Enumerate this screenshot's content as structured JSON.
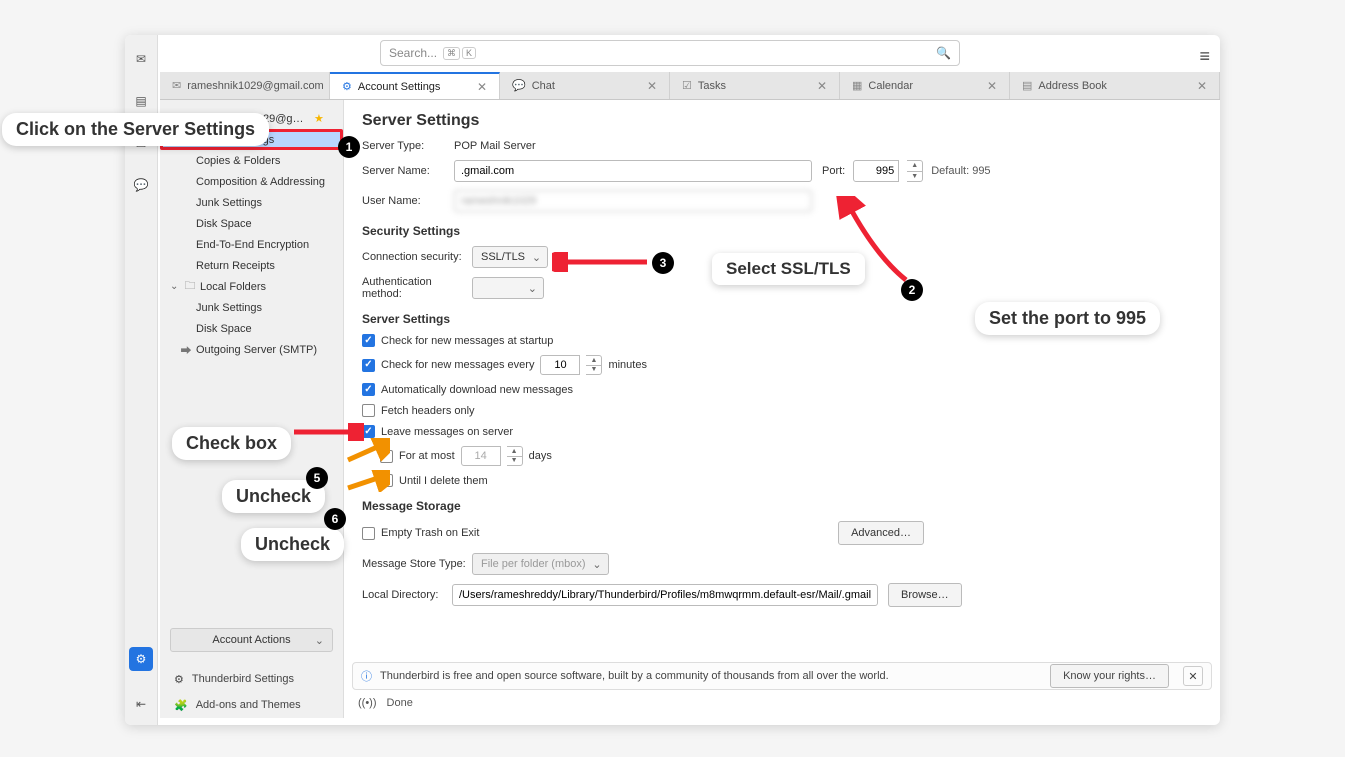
{
  "search": {
    "placeholder": "Search...",
    "chip1": "⌘",
    "chip2": "K"
  },
  "tabs": [
    {
      "label": "rameshnik1029@gmail.com"
    },
    {
      "label": "Account Settings"
    },
    {
      "label": "Chat"
    },
    {
      "label": "Tasks"
    },
    {
      "label": "Calendar"
    },
    {
      "label": "Address Book"
    }
  ],
  "tree": {
    "account": "rameshnik1029@gmail.com",
    "items": [
      "Server Settings",
      "Copies & Folders",
      "Composition & Addressing",
      "Junk Settings",
      "Disk Space",
      "End-To-End Encryption",
      "Return Receipts"
    ],
    "local": {
      "label": "Local Folders",
      "items": [
        "Junk Settings",
        "Disk Space"
      ]
    },
    "smtp": "Outgoing Server (SMTP)",
    "actions": "Account Actions",
    "tb_settings": "Thunderbird Settings",
    "addons": "Add-ons and Themes"
  },
  "page_title": "Server Settings",
  "server_type_lbl": "Server Type:",
  "server_type": "POP Mail Server",
  "server_name_lbl": "Server Name:",
  "server_name": ".gmail.com",
  "port_lbl": "Port:",
  "port": "995",
  "default_port": "Default: 995",
  "user_name_lbl": "User Name:",
  "user_name": "rameshnik1029",
  "security_h": "Security Settings",
  "conn_sec_lbl": "Connection security:",
  "conn_sec": "SSL/TLS",
  "auth_lbl": "Authentication method:",
  "auth": "",
  "server_settings_h": "Server Settings",
  "chk_startup": "Check for new messages at startup",
  "chk_every_pre": "Check for new messages every",
  "chk_every_val": "10",
  "chk_every_post": "minutes",
  "chk_autodl": "Automatically download new messages",
  "chk_headers": "Fetch headers only",
  "chk_leave": "Leave messages on server",
  "chk_atmost_pre": "For at most",
  "chk_atmost_val": "14",
  "chk_atmost_post": "days",
  "chk_until": "Until I delete them",
  "storage_h": "Message Storage",
  "chk_empty_trash": "Empty Trash on Exit",
  "advanced_btn": "Advanced…",
  "store_type_lbl": "Message Store Type:",
  "store_type": "File per folder (mbox)",
  "local_dir_lbl": "Local Directory:",
  "local_dir": "/Users/rameshreddy/Library/Thunderbird/Profiles/m8mwqrmm.default-esr/Mail/.gmail.com",
  "browse_btn": "Browse…",
  "info_text": "Thunderbird is free and open source software, built by a community of thousands from all over the world.",
  "know_rights": "Know your rights…",
  "status_done": "Done",
  "callouts": {
    "c1": "Click on the Server Settings",
    "c2": "Set the port to 995",
    "c3": "Select SSL/TLS",
    "c4": "Check box",
    "c5": "Uncheck",
    "c6": "Uncheck"
  }
}
